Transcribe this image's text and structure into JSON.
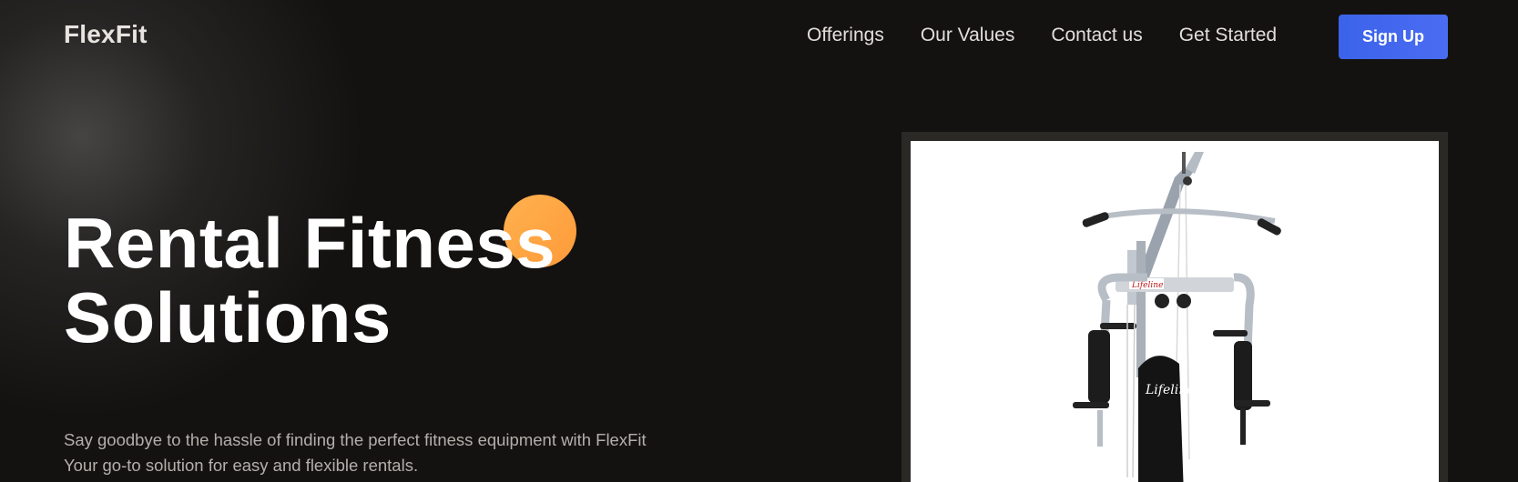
{
  "brand": {
    "name": "FlexFit"
  },
  "nav": {
    "links": [
      "Offerings",
      "Our Values",
      "Contact us",
      "Get Started"
    ],
    "signup_label": "Sign Up"
  },
  "hero": {
    "title_line1": "Rental Fitness",
    "title_line2": "Solutions",
    "subtitle_line1": "Say goodbye to the hassle of finding the perfect fitness equipment with FlexFit",
    "subtitle_line2": "Your go-to solution for easy and flexible rentals.",
    "accent_color": "#ff9f3f",
    "button_color": "#3d63ea"
  },
  "product": {
    "brand_label": "Lifeline"
  }
}
